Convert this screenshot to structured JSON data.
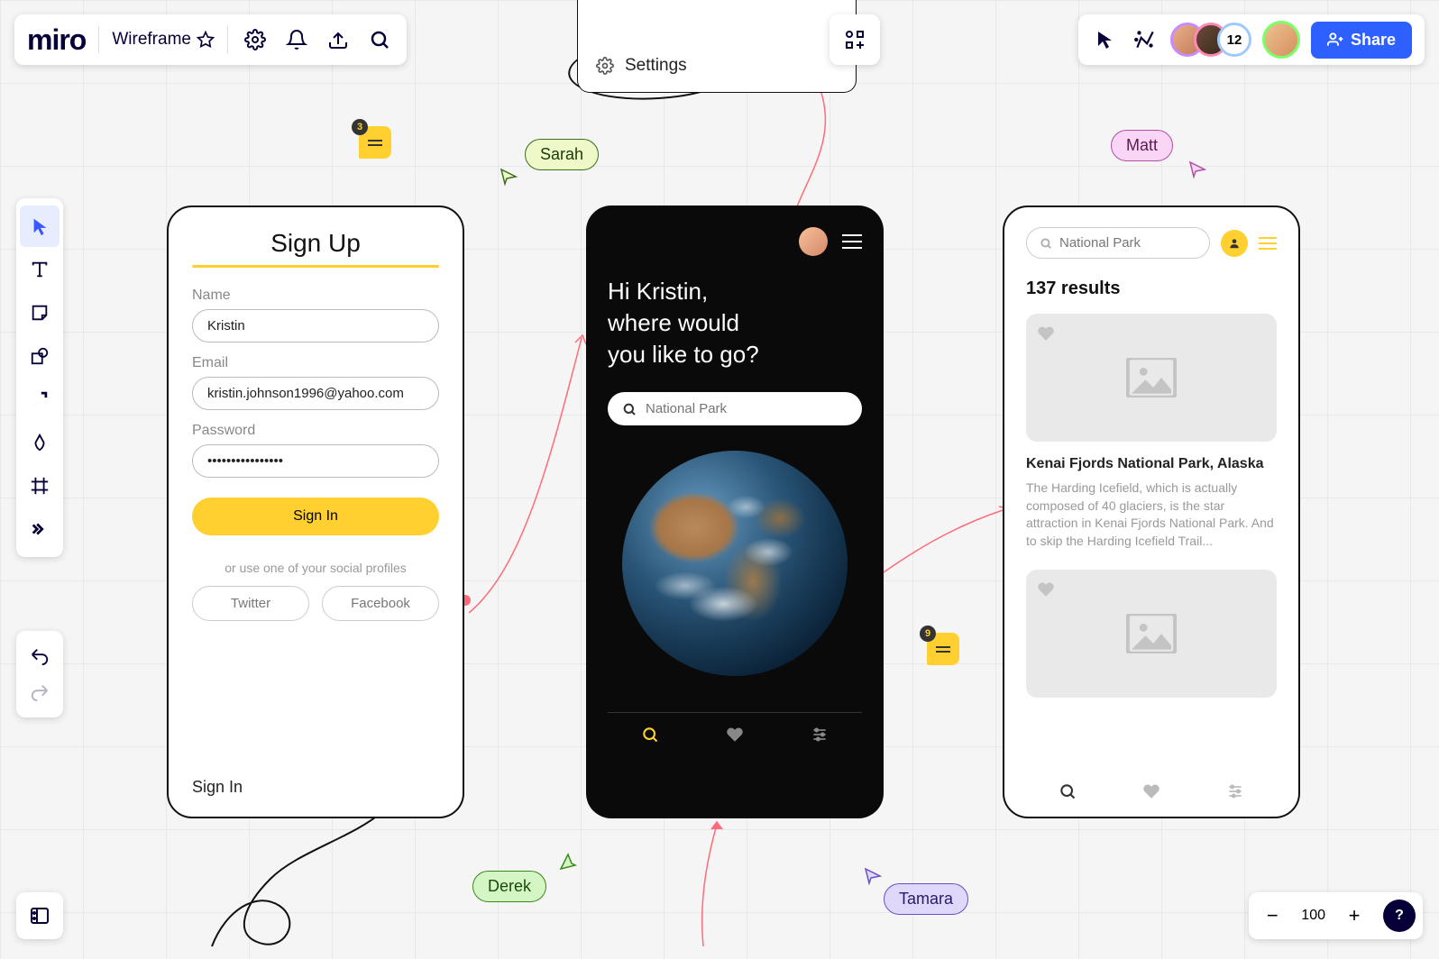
{
  "app": {
    "logo": "miro",
    "board_name": "Wireframe"
  },
  "settings_menu": {
    "label": "Settings"
  },
  "topbar": {
    "share": "Share",
    "count": "12"
  },
  "zoom": {
    "value": "100"
  },
  "cursors": {
    "sarah": "Sarah",
    "matt": "Matt",
    "derek": "Derek",
    "tamara": "Tamara"
  },
  "comments": {
    "pin1": "3",
    "pin2": "9"
  },
  "phone1": {
    "title": "Sign Up",
    "name_label": "Name",
    "name_value": "Kristin",
    "email_label": "Email",
    "email_value": "kristin.johnson1996@yahoo.com",
    "password_label": "Password",
    "password_value": "••••••••••••••••",
    "signin_btn": "Sign In",
    "or_text": "or use one of your social profiles",
    "twitter": "Twitter",
    "facebook": "Facebook",
    "signin_link": "Sign In"
  },
  "phone2": {
    "greeting_line1": "Hi Kristin,",
    "greeting_line2": "where would",
    "greeting_line3": "you like to go?",
    "search_placeholder": "National Park"
  },
  "phone3": {
    "search_value": "National Park",
    "results": "137 results",
    "card1_title": "Kenai Fjords National Park, Alaska",
    "card1_desc": "The Harding Icefield, which is actually composed of 40 glaciers, is the star attraction in Kenai Fjords National Park. And to skip the Harding Icefield Trail..."
  }
}
